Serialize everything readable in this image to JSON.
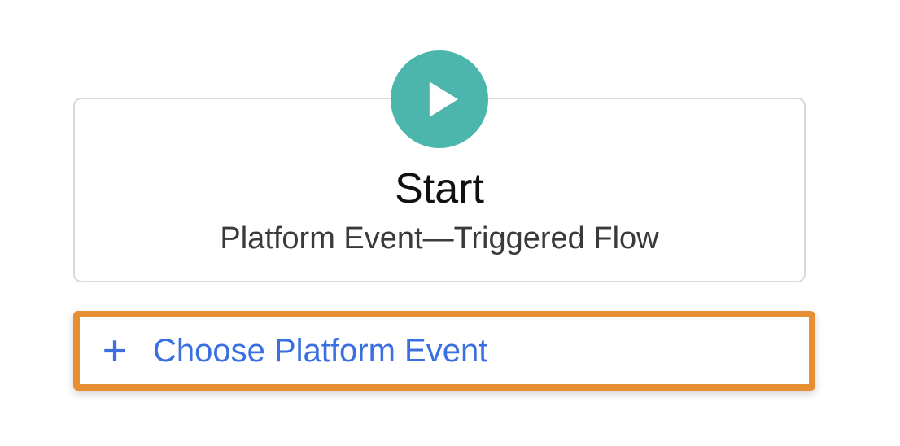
{
  "start": {
    "title": "Start",
    "subtitle": "Platform Event—Triggered Flow"
  },
  "chooseEvent": {
    "label": "Choose Platform Event"
  }
}
